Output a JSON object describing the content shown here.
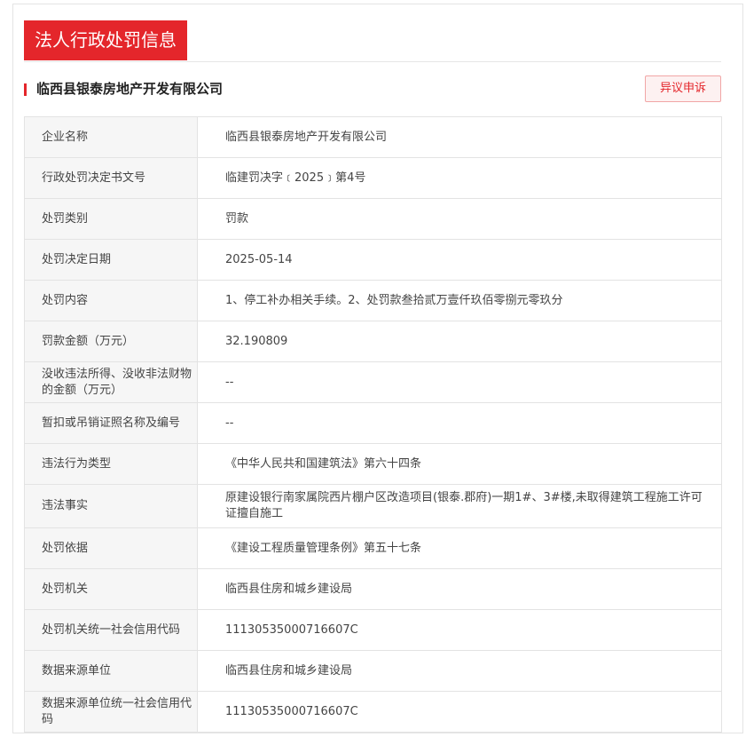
{
  "section_title": "法人行政处罚信息",
  "company": {
    "name": "临西县银泰房地产开发有限公司",
    "objection_label": "异议申诉"
  },
  "rows": [
    {
      "label": "企业名称",
      "value": "临西县银泰房地产开发有限公司"
    },
    {
      "label": "行政处罚决定书文号",
      "value": "临建罚决字﹝2025﹞第4号"
    },
    {
      "label": "处罚类别",
      "value": "罚款"
    },
    {
      "label": "处罚决定日期",
      "value": "2025-05-14"
    },
    {
      "label": "处罚内容",
      "value": "1、停工补办相关手续。2、处罚款叁拾贰万壹仟玖佰零捌元零玖分"
    },
    {
      "label": "罚款金额（万元）",
      "value": "32.190809"
    },
    {
      "label": "没收违法所得、没收非法财物的金额（万元）",
      "value": "--"
    },
    {
      "label": "暂扣或吊销证照名称及编号",
      "value": "--"
    },
    {
      "label": "违法行为类型",
      "value": "《中华人民共和国建筑法》第六十四条"
    },
    {
      "label": "违法事实",
      "value": "原建设银行南家属院西片棚户区改造项目(银泰.郡府)一期1#、3#楼,未取得建筑工程施工许可证擅自施工"
    },
    {
      "label": "处罚依据",
      "value": "《建设工程质量管理条例》第五十七条"
    },
    {
      "label": "处罚机关",
      "value": "临西县住房和城乡建设局"
    },
    {
      "label": "处罚机关统一社会信用代码",
      "value": "11130535000716607C"
    },
    {
      "label": "数据来源单位",
      "value": "临西县住房和城乡建设局"
    },
    {
      "label": "数据来源单位统一社会信用代码",
      "value": "11130535000716607C"
    }
  ],
  "colors": {
    "accent": "#e4262b",
    "label_bg": "#f6f6f6",
    "border": "#e3e3e3"
  }
}
